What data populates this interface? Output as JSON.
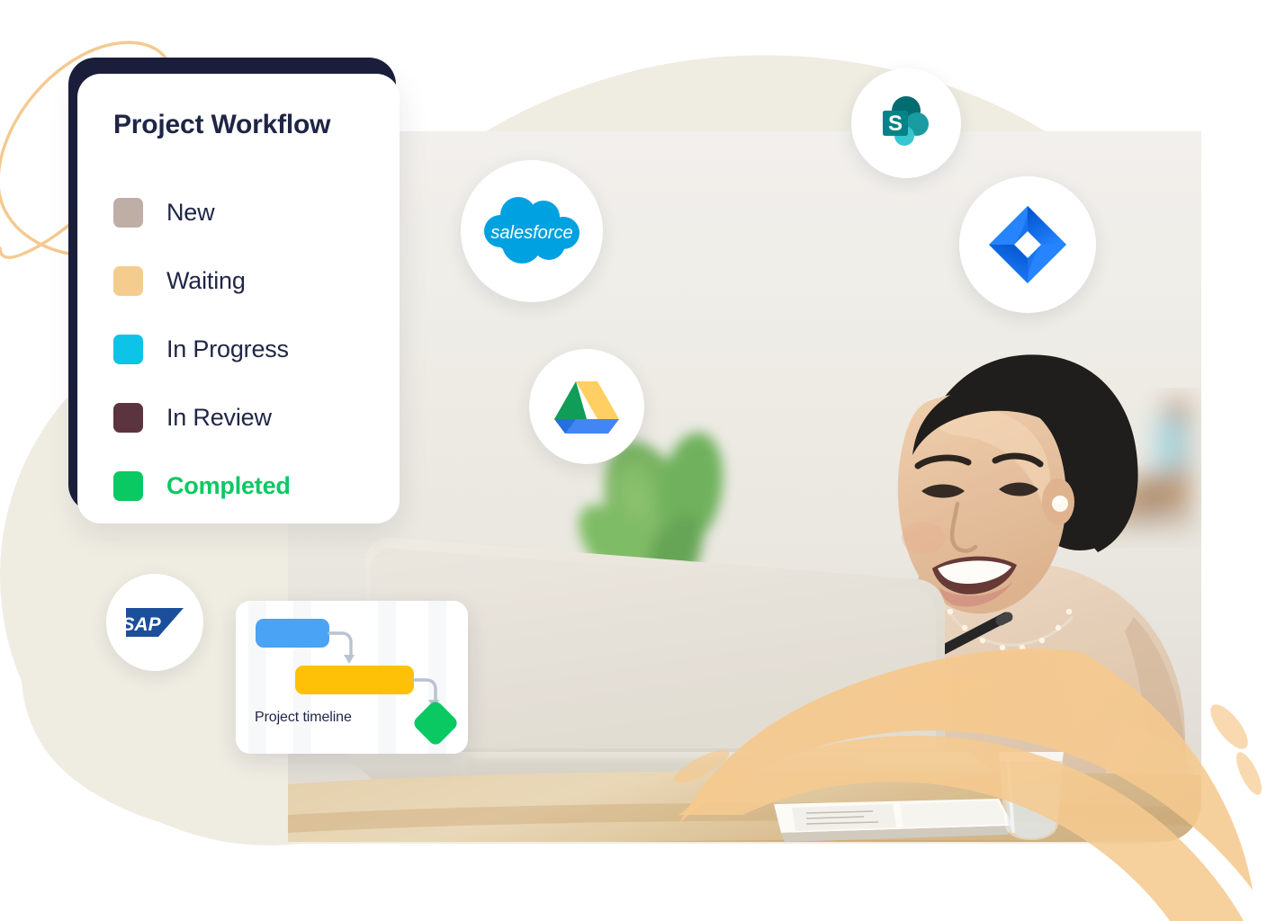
{
  "workflow_card": {
    "title": "Project Workflow",
    "items": [
      {
        "label": "New",
        "color": "#bfaea6",
        "highlight": false
      },
      {
        "label": "Waiting",
        "color": "#f4cd8e",
        "highlight": false
      },
      {
        "label": "In Progress",
        "color": "#0dc3e8",
        "highlight": false
      },
      {
        "label": "In Review",
        "color": "#5c3440",
        "highlight": false
      },
      {
        "label": "Completed",
        "color": "#0ac962",
        "highlight": true
      }
    ]
  },
  "timeline_card": {
    "label": "Project timeline",
    "bars": [
      {
        "name": "task-bar-blue",
        "color": "#4aa3f5"
      },
      {
        "name": "task-bar-yellow",
        "color": "#ffc107"
      }
    ],
    "milestone": {
      "name": "milestone-diamond",
      "color": "#0ac962"
    },
    "connector_color": "#b9c2d0"
  },
  "app_badges": [
    {
      "icon": "sharepoint-icon",
      "name": "SharePoint"
    },
    {
      "icon": "salesforce-icon",
      "name": "Salesforce"
    },
    {
      "icon": "jira-icon",
      "name": "Jira"
    },
    {
      "icon": "google-drive-icon",
      "name": "Google Drive"
    },
    {
      "icon": "sap-icon",
      "name": "SAP"
    }
  ],
  "photo": {
    "alt": "Smiling woman working at a laptop at a wooden desk"
  },
  "colors": {
    "background_blob": "#efece2",
    "dark_card": "#1b1f3b",
    "lasso_stroke": "#f5c98f",
    "brush_stroke": "#f5c98f",
    "text_dark": "#1f2545",
    "accent_green": "#0ac962"
  }
}
